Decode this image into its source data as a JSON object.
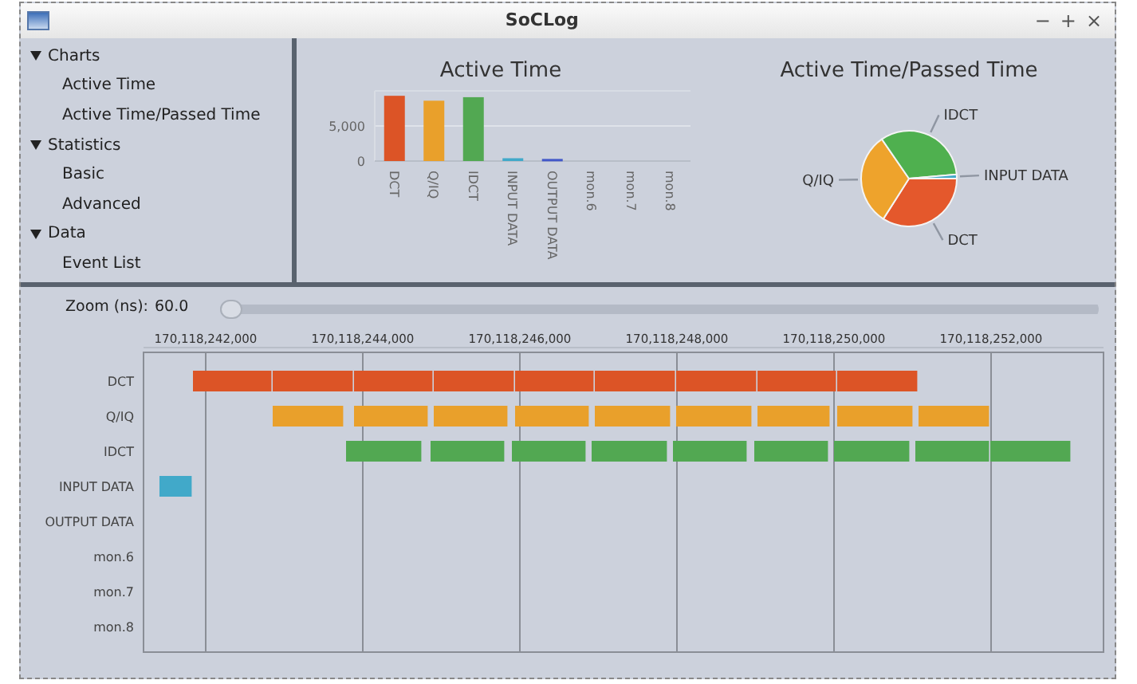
{
  "window": {
    "title": "SoCLog",
    "controls": [
      "−",
      "+",
      "×"
    ]
  },
  "sidebar": {
    "items": [
      {
        "label": "Charts",
        "expanded": true,
        "children": [
          {
            "label": "Active Time"
          },
          {
            "label": "Active Time/Passed Time"
          }
        ]
      },
      {
        "label": "Statistics",
        "expanded": true,
        "children": [
          {
            "label": "Basic"
          },
          {
            "label": "Advanced"
          }
        ]
      },
      {
        "label": "Data",
        "expanded": true,
        "children": [
          {
            "label": "Event List"
          }
        ]
      }
    ]
  },
  "active_time": {
    "chart_data": {
      "type": "bar",
      "title": "Active Time",
      "categories": [
        "DCT",
        "Q/IQ",
        "IDCT",
        "INPUT DATA",
        "OUTPUT DATA",
        "mon.6",
        "mon.7",
        "mon.8"
      ],
      "values": [
        9300,
        8600,
        9100,
        400,
        300,
        0,
        0,
        0
      ],
      "ylim": [
        0,
        10000
      ],
      "yticks": [
        {
          "value": 0,
          "label": "0"
        },
        {
          "value": 5000,
          "label": "5,000"
        }
      ]
    }
  },
  "passed_time": {
    "chart_data": {
      "type": "pie",
      "title": "Active Time/Passed Time",
      "categories": [
        "DCT",
        "Q/IQ",
        "IDCT",
        "INPUT DATA"
      ],
      "values": [
        34.0,
        31.4,
        33.2,
        1.4
      ]
    }
  },
  "timeline": {
    "zoom": {
      "label": "Zoom (ns):",
      "value": "60.0",
      "level": 0
    },
    "ticks": [
      "170,118,242,000",
      "170,118,244,000",
      "170,118,246,000",
      "170,118,248,000",
      "170,118,250,000",
      "170,118,252,000"
    ],
    "rows": [
      {
        "label": "DCT",
        "color": "#dc5426"
      },
      {
        "label": "Q/IQ",
        "color": "#e9a02b"
      },
      {
        "label": "IDCT",
        "color": "#52a852"
      },
      {
        "label": "INPUT DATA",
        "color": "#41a9c9"
      },
      {
        "label": "OUTPUT DATA"
      },
      {
        "label": "mon.6"
      },
      {
        "label": "mon.7"
      },
      {
        "label": "mon.8"
      }
    ]
  }
}
